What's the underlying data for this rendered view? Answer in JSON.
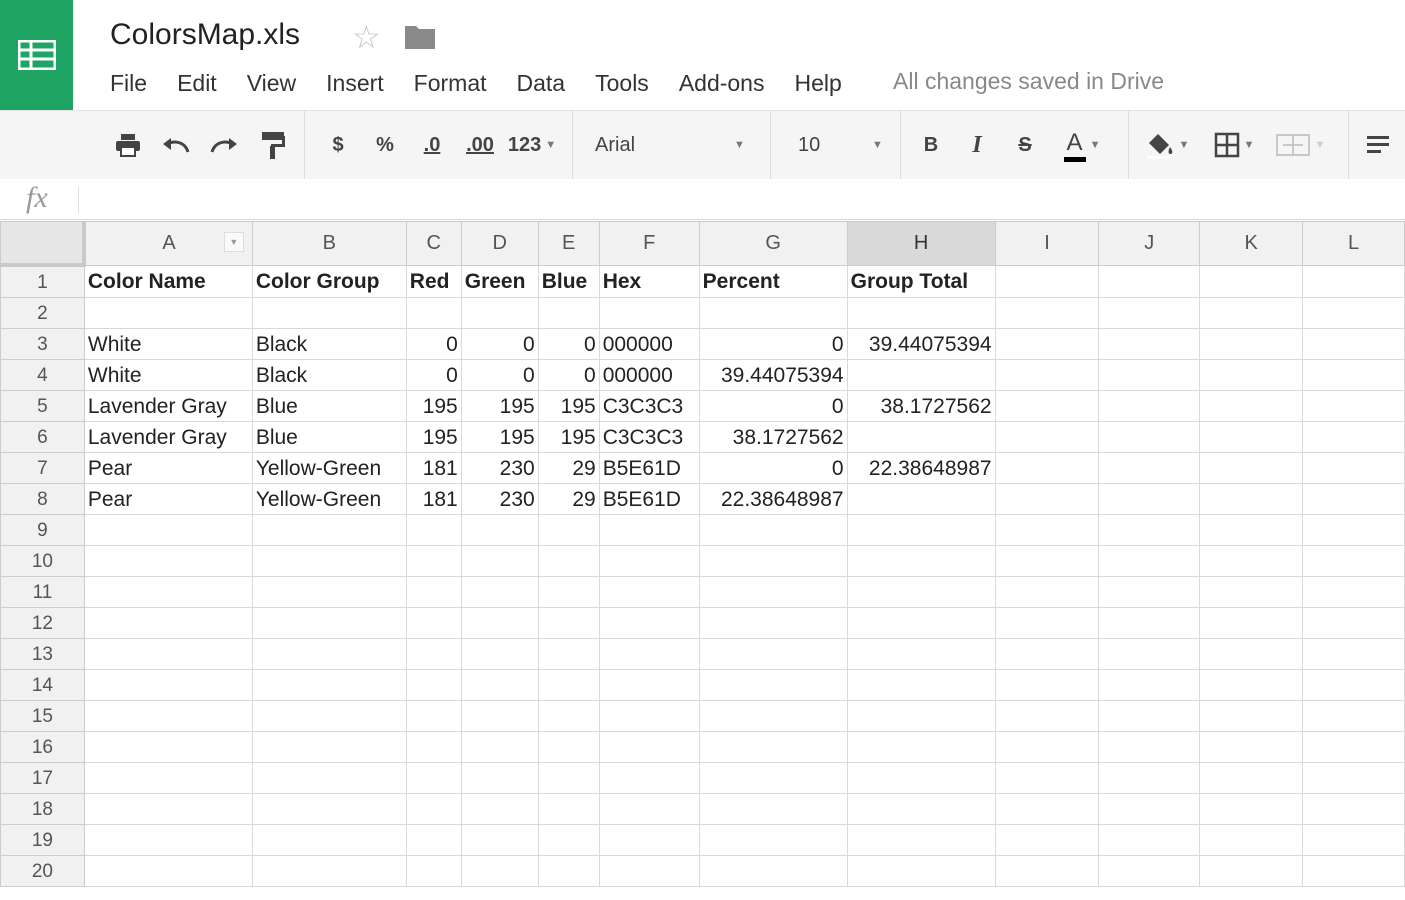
{
  "document": {
    "title": "ColorsMap.xls",
    "save_status": "All changes saved in Drive"
  },
  "menu": [
    "File",
    "Edit",
    "View",
    "Insert",
    "Format",
    "Data",
    "Tools",
    "Add-ons",
    "Help"
  ],
  "toolbar": {
    "currency": "$",
    "percent": "%",
    "decrease_decimals": ".0",
    "increase_decimals": ".00",
    "more_formats": "123",
    "font": "Arial",
    "font_size": "10",
    "bold": "B",
    "italic": "I",
    "strikethrough": "S",
    "text_color": "A"
  },
  "formula_bar": {
    "label": "fx",
    "value": ""
  },
  "columns": [
    "A",
    "B",
    "C",
    "D",
    "E",
    "F",
    "G",
    "H",
    "I",
    "J",
    "K",
    "L"
  ],
  "rows": [
    {
      "n": "1",
      "cells": [
        "Color Name",
        "Color Group",
        "Red",
        "Green",
        "Blue",
        "Hex",
        "Percent",
        "Group Total",
        "",
        "",
        "",
        ""
      ]
    },
    {
      "n": "2",
      "cells": [
        "",
        "",
        "",
        "",
        "",
        "",
        "",
        "",
        "",
        "",
        "",
        ""
      ]
    },
    {
      "n": "3",
      "cells": [
        "White",
        "Black",
        "0",
        "0",
        "0",
        "000000",
        "0",
        "39.44075394",
        "",
        "",
        "",
        ""
      ]
    },
    {
      "n": "4",
      "cells": [
        "White",
        "Black",
        "0",
        "0",
        "0",
        "000000",
        "39.44075394",
        "",
        "",
        "",
        "",
        ""
      ]
    },
    {
      "n": "5",
      "cells": [
        "Lavender Gray",
        "Blue",
        "195",
        "195",
        "195",
        "C3C3C3",
        "0",
        "38.1727562",
        "",
        "",
        "",
        ""
      ]
    },
    {
      "n": "6",
      "cells": [
        "Lavender Gray",
        "Blue",
        "195",
        "195",
        "195",
        "C3C3C3",
        "38.1727562",
        "",
        "",
        "",
        "",
        ""
      ]
    },
    {
      "n": "7",
      "cells": [
        "Pear",
        "Yellow-Green",
        "181",
        "230",
        "29",
        "B5E61D",
        "0",
        "22.38648987",
        "",
        "",
        "",
        ""
      ]
    },
    {
      "n": "8",
      "cells": [
        "Pear",
        "Yellow-Green",
        "181",
        "230",
        "29",
        "B5E61D",
        "22.38648987",
        "",
        "",
        "",
        "",
        ""
      ]
    },
    {
      "n": "9",
      "cells": [
        "",
        "",
        "",
        "",
        "",
        "",
        "",
        "",
        "",
        "",
        "",
        ""
      ]
    },
    {
      "n": "10",
      "cells": [
        "",
        "",
        "",
        "",
        "",
        "",
        "",
        "",
        "",
        "",
        "",
        ""
      ]
    },
    {
      "n": "11",
      "cells": [
        "",
        "",
        "",
        "",
        "",
        "",
        "",
        "",
        "",
        "",
        "",
        ""
      ]
    },
    {
      "n": "12",
      "cells": [
        "",
        "",
        "",
        "",
        "",
        "",
        "",
        "",
        "",
        "",
        "",
        ""
      ]
    },
    {
      "n": "13",
      "cells": [
        "",
        "",
        "",
        "",
        "",
        "",
        "",
        "",
        "",
        "",
        "",
        ""
      ]
    },
    {
      "n": "14",
      "cells": [
        "",
        "",
        "",
        "",
        "",
        "",
        "",
        "",
        "",
        "",
        "",
        ""
      ]
    },
    {
      "n": "15",
      "cells": [
        "",
        "",
        "",
        "",
        "",
        "",
        "",
        "",
        "",
        "",
        "",
        ""
      ]
    },
    {
      "n": "16",
      "cells": [
        "",
        "",
        "",
        "",
        "",
        "",
        "",
        "",
        "",
        "",
        "",
        ""
      ]
    },
    {
      "n": "17",
      "cells": [
        "",
        "",
        "",
        "",
        "",
        "",
        "",
        "",
        "",
        "",
        "",
        ""
      ]
    },
    {
      "n": "18",
      "cells": [
        "",
        "",
        "",
        "",
        "",
        "",
        "",
        "",
        "",
        "",
        "",
        ""
      ]
    },
    {
      "n": "19",
      "cells": [
        "",
        "",
        "",
        "",
        "",
        "",
        "",
        "",
        "",
        "",
        "",
        ""
      ]
    },
    {
      "n": "20",
      "cells": [
        "",
        "",
        "",
        "",
        "",
        "",
        "",
        "",
        "",
        "",
        "",
        ""
      ]
    }
  ],
  "selected_column": "H",
  "colors": {
    "brand": "#1fa463",
    "selected_header": "#d9d9d9"
  }
}
